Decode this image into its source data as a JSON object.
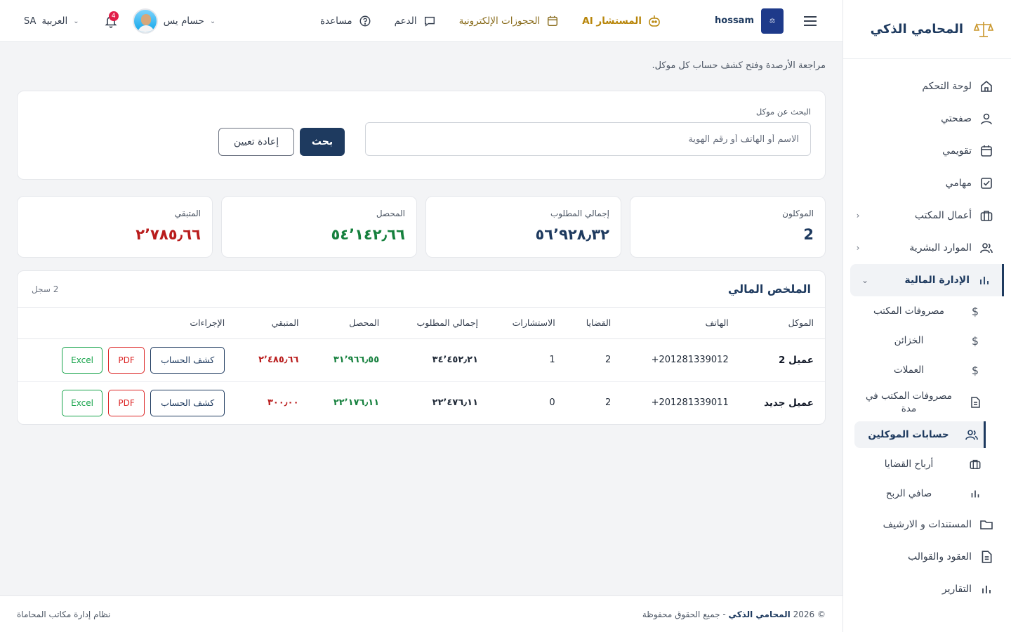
{
  "brand": {
    "name": "المحامي الذكي",
    "logo_icon": "scales-of-justice-icon"
  },
  "sidebar": {
    "items": [
      {
        "label": "لوحة التحكم",
        "icon": "home-icon"
      },
      {
        "label": "صفحتي",
        "icon": "user-icon"
      },
      {
        "label": "تقويمي",
        "icon": "calendar-icon"
      },
      {
        "label": "مهامي",
        "icon": "check-square-icon"
      },
      {
        "label": "أعمال المكتب",
        "icon": "briefcase-icon",
        "has_arrow": true
      },
      {
        "label": "الموارد البشرية",
        "icon": "users-icon",
        "has_arrow": true
      },
      {
        "label": "الإدارة المالية",
        "icon": "bar-chart-icon",
        "has_arrow": true,
        "open": true
      }
    ],
    "finance_sub": [
      {
        "label": "مصروفات المكتب",
        "icon": "dollar-icon"
      },
      {
        "label": "الخزائن",
        "icon": "dollar-icon"
      },
      {
        "label": "العملات",
        "icon": "dollar-icon"
      },
      {
        "label": "مصروفات المكتب في مدة",
        "icon": "document-icon"
      },
      {
        "label": "حسابات الموكلين",
        "icon": "users-icon",
        "active": true
      },
      {
        "label": "أرباح القضايا",
        "icon": "briefcase-icon"
      },
      {
        "label": "صافي الربح",
        "icon": "bar-chart-icon"
      }
    ],
    "after": [
      {
        "label": "المستندات و الارشيف",
        "icon": "folder-icon"
      },
      {
        "label": "العقود والقوالب",
        "icon": "document-icon"
      },
      {
        "label": "التقارير",
        "icon": "bar-chart-icon"
      }
    ]
  },
  "topbar": {
    "office_name": "hossam",
    "ai_label": "المستشار AI",
    "bookings_label": "الحجوزات الإلكترونية",
    "support_label": "الدعم",
    "help_label": "مساعدة",
    "lang_code": "SA",
    "lang_label": "العربية",
    "notifications_count": "4",
    "user_name": "حسام يس"
  },
  "page": {
    "subtitle": "مراجعة الأرصدة وفتح كشف حساب كل موكل."
  },
  "search": {
    "label": "البحث عن موكل",
    "placeholder": "الاسم أو الهاتف أو رقم الهوية",
    "search_button": "بحث",
    "reset_button": "إعادة تعيين"
  },
  "stats": {
    "clients_label": "الموكلون",
    "clients_value": "2",
    "total_label": "إجمالي المطلوب",
    "total_value": "٥٦٬٩٢٨٫٣٢",
    "collected_label": "المحصل",
    "collected_value": "٥٤٬١٤٢٫٦٦",
    "remaining_label": "المتبقي",
    "remaining_value": "٢٬٧٨٥٫٦٦"
  },
  "table": {
    "title": "الملخص المالي",
    "count": "2 سجل",
    "columns": [
      "الموكل",
      "الهاتف",
      "القضايا",
      "الاستشارات",
      "إجمالي المطلوب",
      "المحصل",
      "المتبقي",
      "الإجراءات"
    ],
    "rows": [
      {
        "client": "عميل 2",
        "phone": "201281339012+",
        "cases": "2",
        "consults": "1",
        "total": "٣٤٬٤٥٢٫٢١",
        "collected": "٣١٬٩٦٦٫٥٥",
        "remaining": "٢٬٤٨٥٫٦٦"
      },
      {
        "client": "عميل جديد",
        "phone": "201281339011+",
        "cases": "2",
        "consults": "0",
        "total": "٢٢٬٤٧٦٫١١",
        "collected": "٢٢٬١٧٦٫١١",
        "remaining": "٣٠٠٫٠٠"
      }
    ],
    "statement_button": "كشف الحساب",
    "pdf_button": "PDF",
    "excel_button": "Excel"
  },
  "footer": {
    "copyright_prefix": "© 2026",
    "brand": "المحامي الذكي",
    "rights": "- جميع الحقوق محفوظة",
    "system": "نظام إدارة مكاتب المحاماة"
  },
  "colors": {
    "primary": "#1e3a5f",
    "success": "#15803d",
    "danger": "#b91c1c",
    "ai_gold": "#b8860b"
  }
}
